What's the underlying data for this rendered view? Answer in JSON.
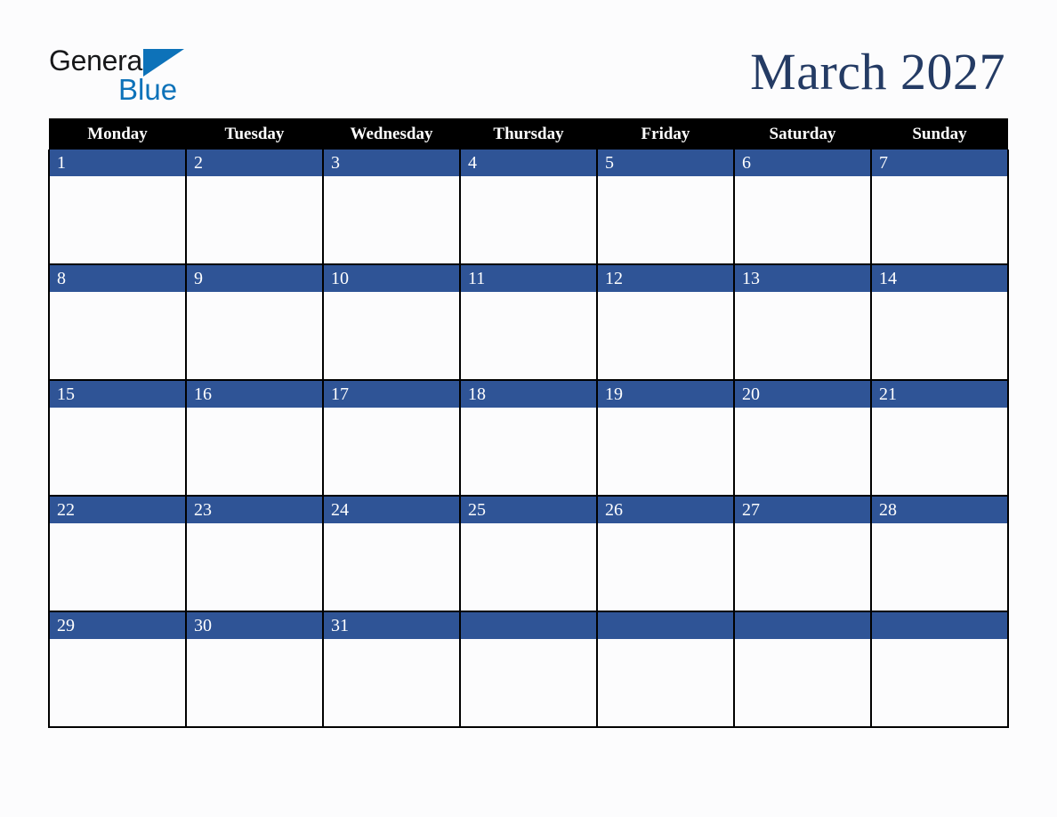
{
  "brand": {
    "name_part1": "General",
    "name_part2": "Blue",
    "triangle_icon": "triangle-icon",
    "colors": {
      "black": "#17181a",
      "blue": "#0d72b9"
    }
  },
  "header": {
    "title": "March 2027",
    "title_color": "#243b64"
  },
  "calendar": {
    "accent_color": "#2f5496",
    "header_bg": "#000000",
    "header_fg": "#ffffff",
    "weekday_headers": [
      "Monday",
      "Tuesday",
      "Wednesday",
      "Thursday",
      "Friday",
      "Saturday",
      "Sunday"
    ],
    "weeks": [
      {
        "days": [
          "1",
          "2",
          "3",
          "4",
          "5",
          "6",
          "7"
        ]
      },
      {
        "days": [
          "8",
          "9",
          "10",
          "11",
          "12",
          "13",
          "14"
        ]
      },
      {
        "days": [
          "15",
          "16",
          "17",
          "18",
          "19",
          "20",
          "21"
        ]
      },
      {
        "days": [
          "22",
          "23",
          "24",
          "25",
          "26",
          "27",
          "28"
        ]
      },
      {
        "days": [
          "29",
          "30",
          "31",
          "",
          "",
          "",
          ""
        ]
      }
    ]
  }
}
